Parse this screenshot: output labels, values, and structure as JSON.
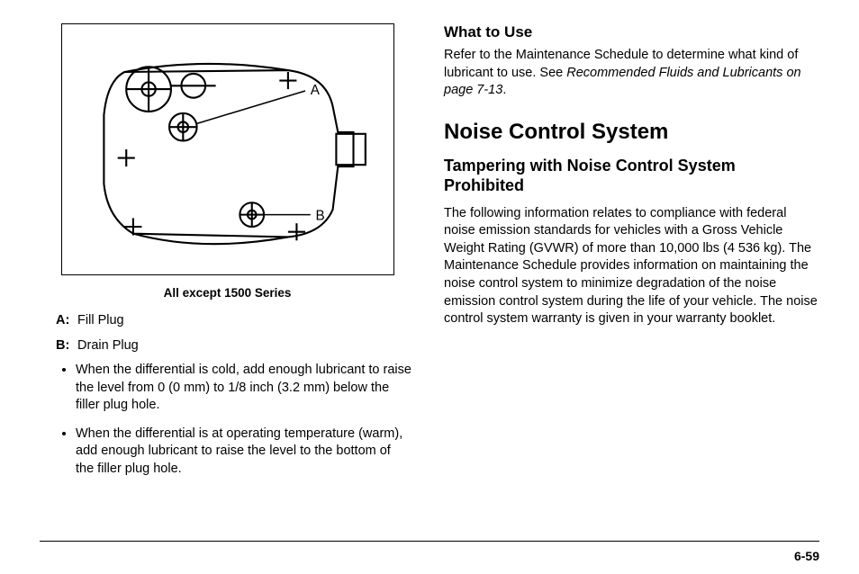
{
  "left": {
    "figure_caption": "All except 1500 Series",
    "figure_labels": {
      "a": "A",
      "b": "B"
    },
    "legend": [
      {
        "key": "A:",
        "label": "Fill Plug"
      },
      {
        "key": "B:",
        "label": "Drain Plug"
      }
    ],
    "bullets": [
      "When the differential is cold, add enough lubricant to raise the level from 0 (0 mm) to 1/8 inch (3.2 mm) below the filler plug hole.",
      "When the differential is at operating temperature (warm), add enough lubricant to raise the level to the bottom of the filler plug hole."
    ]
  },
  "right": {
    "what_heading": "What to Use",
    "what_body_pre": "Refer to the Maintenance Schedule to determine what kind of lubricant to use. See ",
    "what_body_ital": "Recommended Fluids and Lubricants on page 7-13",
    "what_body_post": ".",
    "section_heading": "Noise Control System",
    "subsection_heading": "Tampering with Noise Control System Prohibited",
    "subsection_body": "The following information relates to compliance with federal noise emission standards for vehicles with a Gross Vehicle Weight Rating (GVWR) of more than 10,000 lbs (4 536 kg). The Maintenance Schedule provides information on maintaining the noise control system to minimize degradation of the noise emission control system during the life of your vehicle. The noise control system warranty is given in your warranty booklet."
  },
  "page_number": "6-59"
}
